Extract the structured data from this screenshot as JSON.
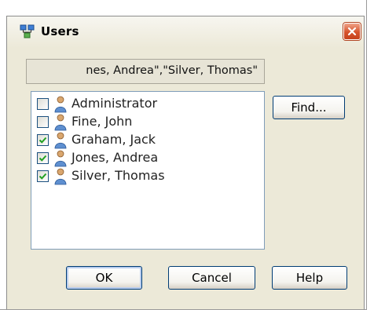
{
  "window": {
    "title": "Users",
    "close_icon": "close-icon",
    "app_icon": "users-dialog-icon"
  },
  "names_field": {
    "value": "nes, Andrea\",\"Silver, Thomas\""
  },
  "users": [
    {
      "name": "Administrator",
      "checked": false,
      "icon": "user-icon"
    },
    {
      "name": "Fine, John",
      "checked": false,
      "icon": "user-icon"
    },
    {
      "name": "Graham, Jack",
      "checked": true,
      "icon": "user-icon"
    },
    {
      "name": "Jones, Andrea",
      "checked": true,
      "icon": "user-icon"
    },
    {
      "name": "Silver, Thomas",
      "checked": true,
      "icon": "user-icon"
    }
  ],
  "buttons": {
    "find": "Find...",
    "ok": "OK",
    "cancel": "Cancel",
    "help": "Help"
  },
  "colors": {
    "dialog_bg": "#ece9d8",
    "close_red": "#d6532c",
    "check_green": "#21a121",
    "button_border": "#003c74"
  }
}
